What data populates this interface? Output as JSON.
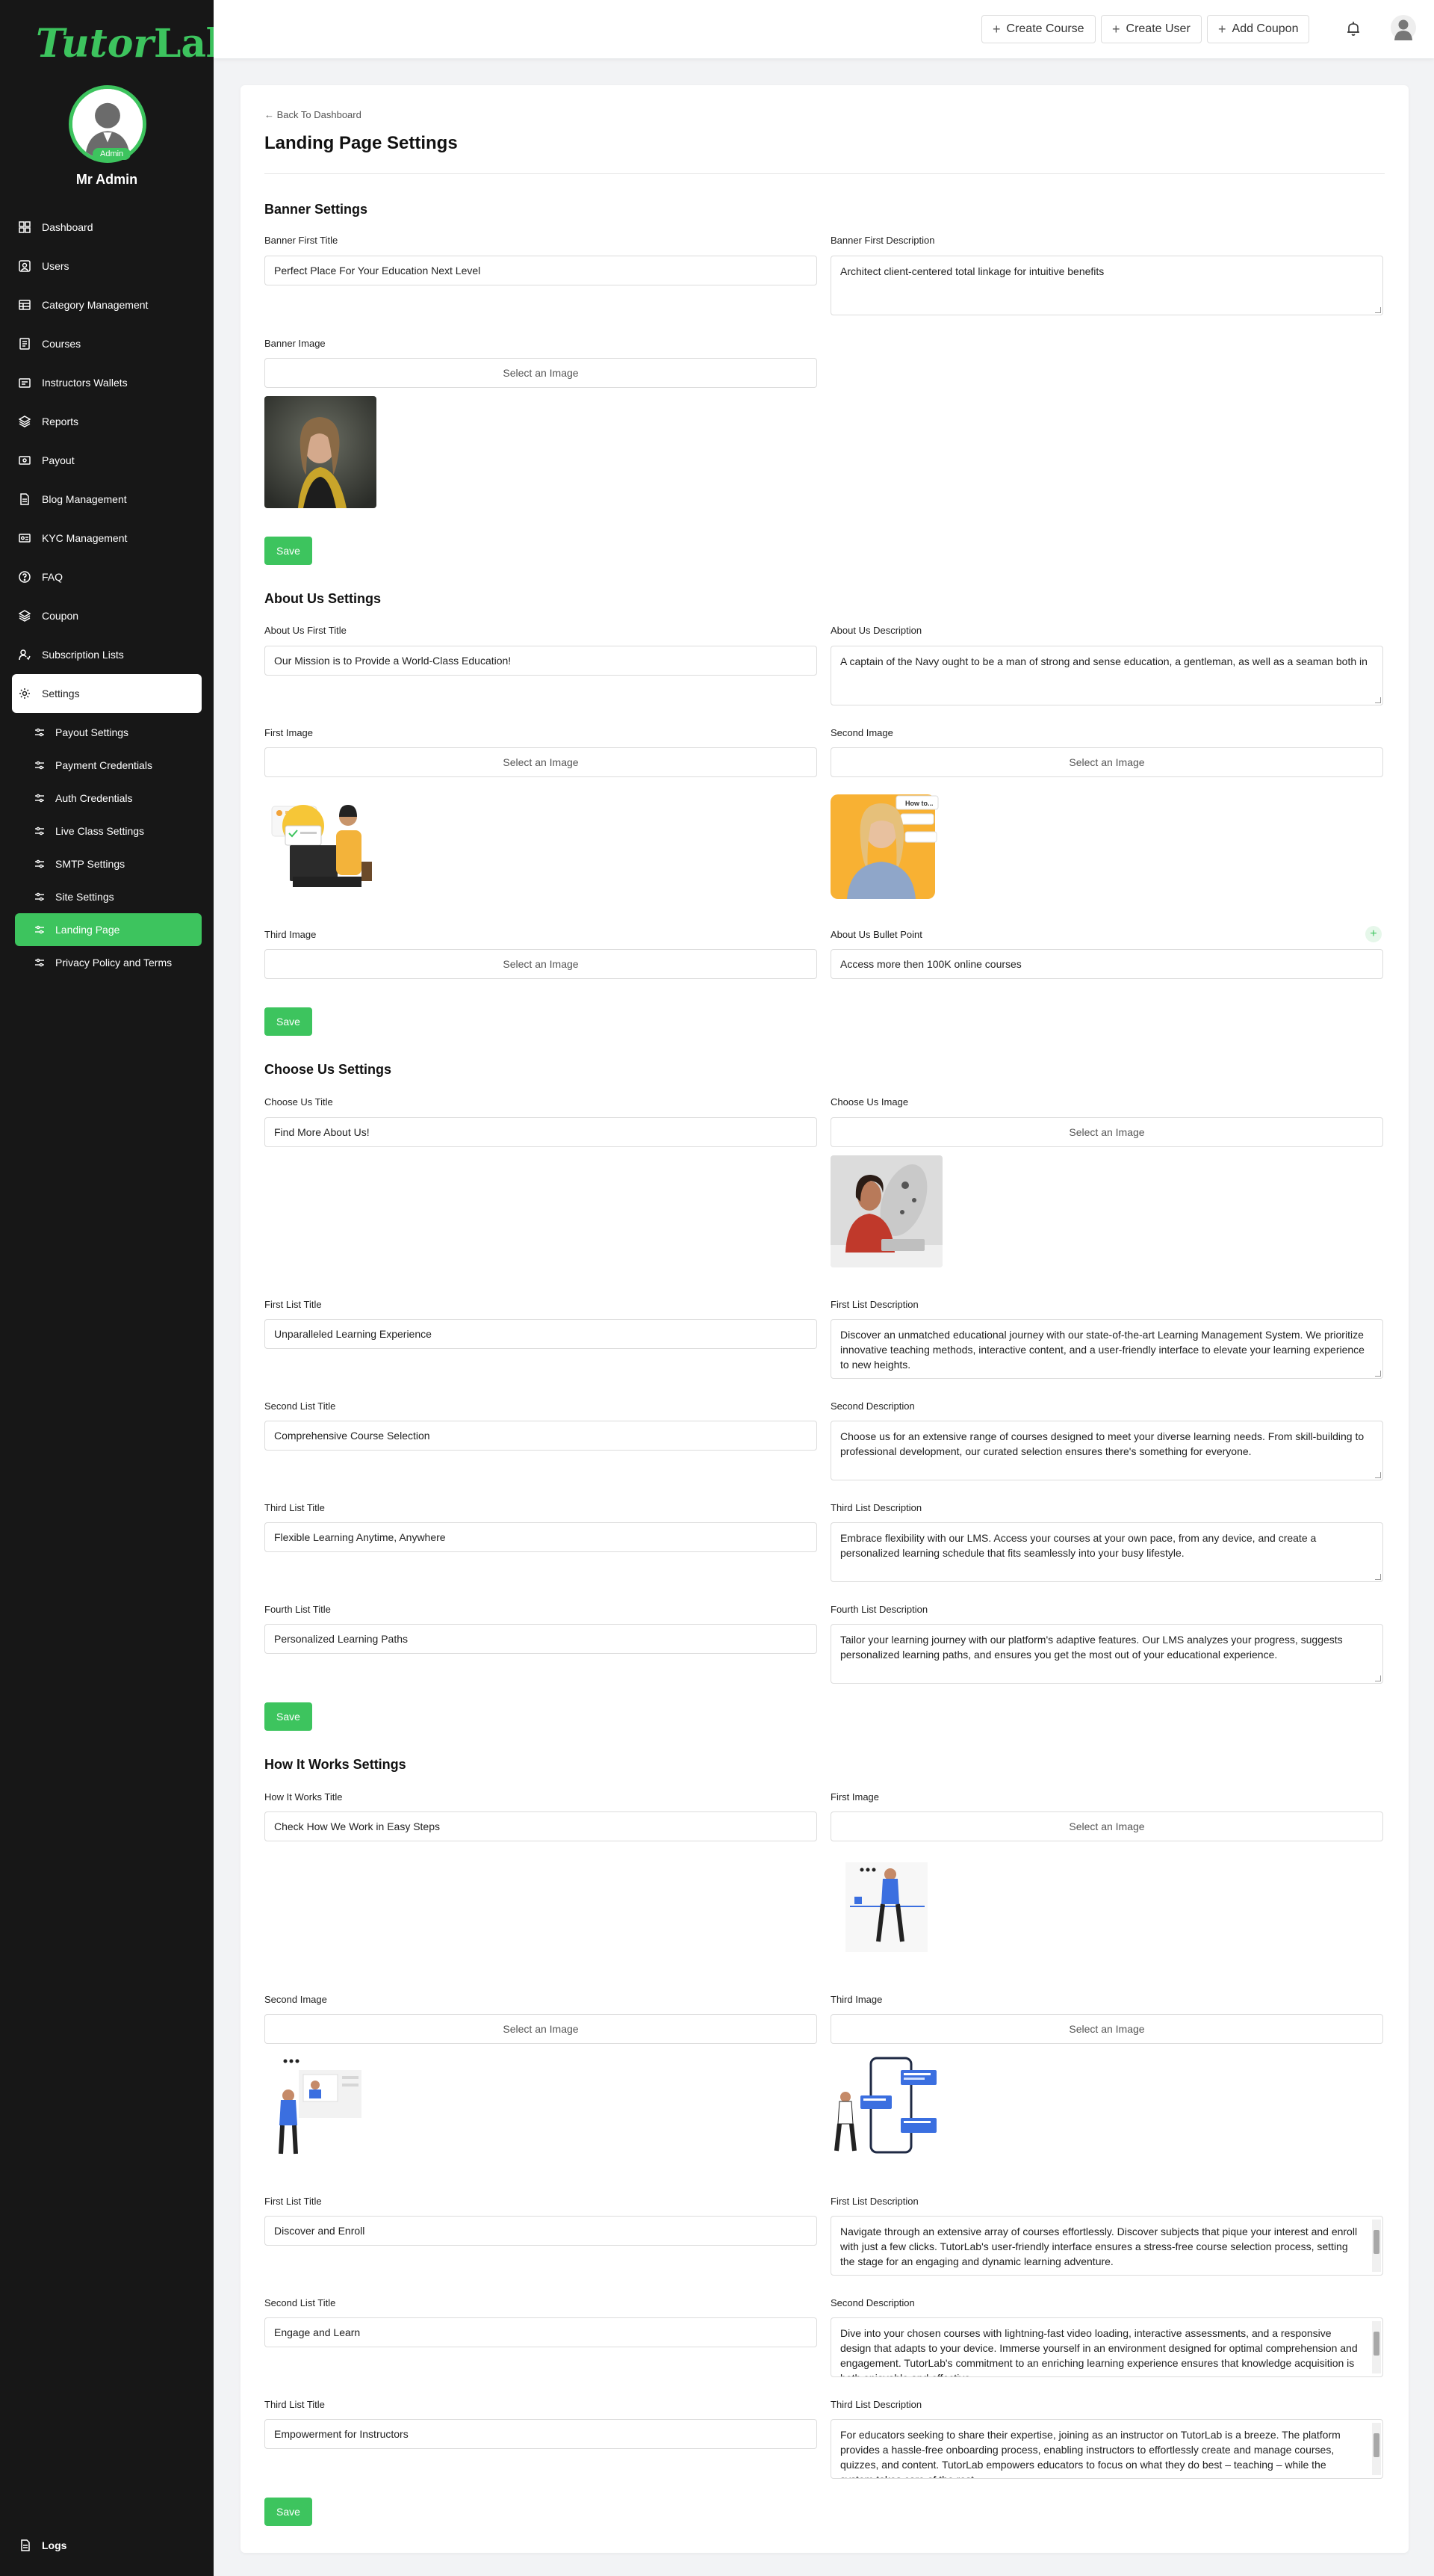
{
  "sidebar": {
    "logo_part1": "Tutor",
    "logo_part2": "Lab",
    "admin_badge": "Admin",
    "user_name": "Mr Admin",
    "nav": [
      {
        "label": "Dashboard",
        "icon": "dashboard-icon"
      },
      {
        "label": "Users",
        "icon": "users-icon"
      },
      {
        "label": "Category Management",
        "icon": "category-icon"
      },
      {
        "label": "Courses",
        "icon": "courses-icon"
      },
      {
        "label": "Instructors Wallets",
        "icon": "wallet-icon"
      },
      {
        "label": "Reports",
        "icon": "reports-icon"
      },
      {
        "label": "Payout",
        "icon": "payout-icon"
      },
      {
        "label": "Blog Management",
        "icon": "blog-icon"
      },
      {
        "label": "KYC Management",
        "icon": "kyc-icon"
      },
      {
        "label": "FAQ",
        "icon": "faq-icon"
      },
      {
        "label": "Coupon",
        "icon": "coupon-icon"
      },
      {
        "label": "Subscription Lists",
        "icon": "subscription-icon"
      },
      {
        "label": "Settings",
        "icon": "settings-icon"
      }
    ],
    "settings_sub": [
      {
        "label": "Payout Settings"
      },
      {
        "label": "Payment Credentials"
      },
      {
        "label": "Auth Credentials"
      },
      {
        "label": "Live Class Settings"
      },
      {
        "label": "SMTP Settings"
      },
      {
        "label": "Site Settings"
      },
      {
        "label": "Landing Page"
      },
      {
        "label": "Privacy Policy and Terms"
      }
    ],
    "logs": "Logs"
  },
  "topbar": {
    "create_course": "Create Course",
    "create_user": "Create User",
    "add_coupon": "Add Coupon"
  },
  "page": {
    "back": "Back To Dashboard",
    "title": "Landing Page Settings"
  },
  "common": {
    "select_image": "Select an Image",
    "save": "Save"
  },
  "banner": {
    "heading": "Banner Settings",
    "first_title_label": "Banner First Title",
    "first_title_value": "Perfect Place For Your Education Next Level",
    "first_desc_label": "Banner First Description",
    "first_desc_value": "Architect client-centered total linkage for intuitive benefits",
    "image_label": "Banner Image"
  },
  "about": {
    "heading": "About Us Settings",
    "first_title_label": "About Us First Title",
    "first_title_value": "Our Mission is to Provide a World-Class Education!",
    "desc_label": "About Us Description",
    "desc_value": "A captain of the Navy ought to be a man of strong and sense education, a gentleman, as well as a seaman both in",
    "first_image_label": "First Image",
    "second_image_label": "Second Image",
    "third_image_label": "Third Image",
    "bullet_label": "About Us Bullet Point",
    "bullet_value": "Access more then 100K online courses"
  },
  "choose": {
    "heading": "Choose Us Settings",
    "title_label": "Choose Us Title",
    "title_value": "Find More About Us!",
    "image_label": "Choose Us Image",
    "first_list_title_label": "First List Title",
    "first_list_title_value": "Unparalleled Learning Experience",
    "first_list_desc_label": "First List Description",
    "first_list_desc_value": "Discover an unmatched educational journey with our state-of-the-art Learning Management System. We prioritize innovative teaching methods, interactive content, and a user-friendly interface to elevate your learning experience to new heights.",
    "second_list_title_label": "Second List Title",
    "second_list_title_value": "Comprehensive Course Selection",
    "second_desc_label": "Second Description",
    "second_desc_value": "Choose us for an extensive range of courses designed to meet your diverse learning needs. From skill-building to professional development, our curated selection ensures there's something for everyone.",
    "third_list_title_label": "Third List Title",
    "third_list_title_value": "Flexible Learning Anytime, Anywhere",
    "third_list_desc_label": "Third List Description",
    "third_list_desc_value": "Embrace flexibility with our LMS. Access your courses at your own pace, from any device, and create a personalized learning schedule that fits seamlessly into your busy lifestyle.",
    "fourth_list_title_label": "Fourth List Title",
    "fourth_list_title_value": "Personalized Learning Paths",
    "fourth_list_desc_label": "Fourth List Description",
    "fourth_list_desc_value": "Tailor your learning journey with our platform's adaptive features. Our LMS analyzes your progress, suggests personalized learning paths, and ensures you get the most out of your educational experience."
  },
  "how": {
    "heading": "How It Works Settings",
    "title_label": "How It Works Title",
    "title_value": "Check How We Work in Easy Steps",
    "first_image_label": "First Image",
    "second_image_label": "Second Image",
    "third_image_label": "Third Image",
    "first_list_title_label": "First List Title",
    "first_list_title_value": "Discover and Enroll",
    "first_list_desc_label": "First List Description",
    "first_list_desc_value": "Navigate through an extensive array of courses effortlessly. Discover subjects that pique your interest and enroll with just a few clicks. TutorLab's user-friendly interface ensures a stress-free course selection process, setting the stage for an engaging and dynamic learning adventure.",
    "second_list_title_label": "Second List Title",
    "second_list_title_value": "Engage and Learn",
    "second_desc_label": "Second Description",
    "second_desc_value": "Dive into your chosen courses with lightning-fast video loading, interactive assessments, and a responsive design that adapts to your device. Immerse yourself in an environment designed for optimal comprehension and engagement. TutorLab's commitment to an enriching learning experience ensures that knowledge acquisition is both enjoyable and effective.",
    "third_list_title_label": "Third List Title",
    "third_list_title_value": "Empowerment for Instructors",
    "third_list_desc_label": "Third List Description",
    "third_list_desc_value": "For educators seeking to share their expertise, joining as an instructor on TutorLab is a breeze. The platform provides a hassle-free onboarding process, enabling instructors to effortlessly create and manage courses, quizzes, and content. TutorLab empowers educators to focus on what they do best – teaching – while the system takes care of the rest."
  },
  "colors": {
    "accent": "#3dc45e",
    "sidebar_bg": "#171717"
  }
}
